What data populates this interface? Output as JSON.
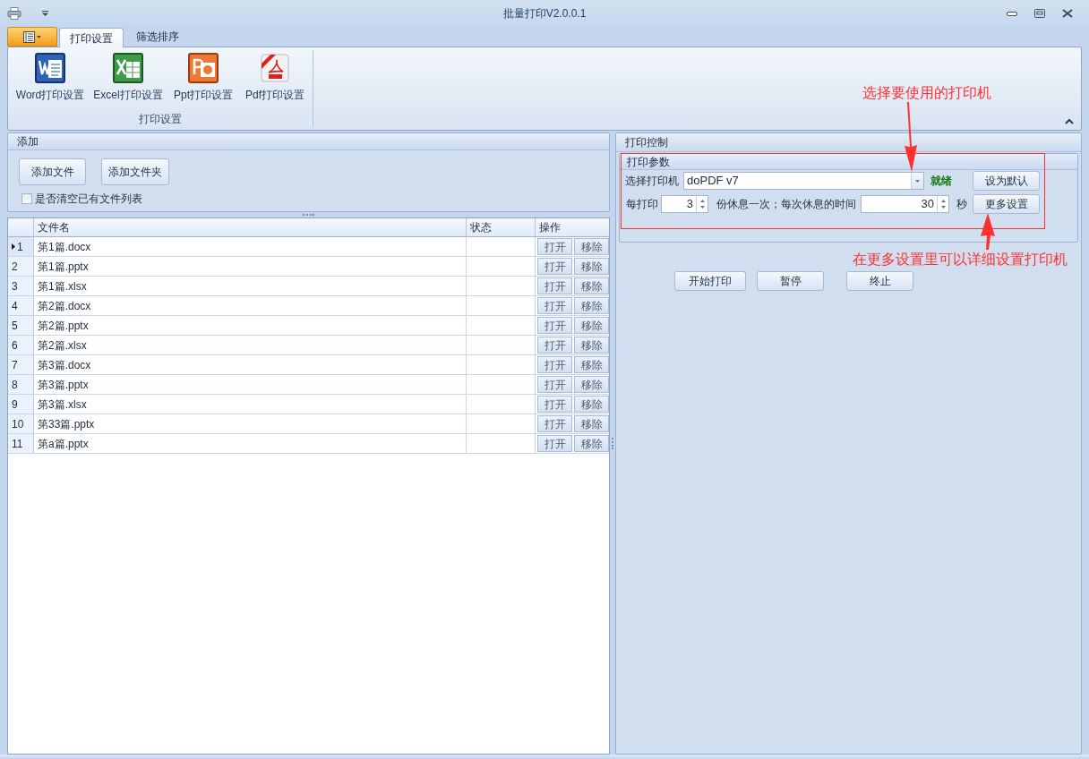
{
  "window": {
    "title": "批量打印V2.0.0.1"
  },
  "ribbon": {
    "tabs": [
      {
        "label": "打印设置",
        "selected": true
      },
      {
        "label": "筛选排序",
        "selected": false
      }
    ],
    "groups": [
      {
        "label": "打印设置",
        "buttons": [
          {
            "label": "Word打印设置",
            "kind": "word"
          },
          {
            "label": "Excel打印设置",
            "kind": "excel"
          },
          {
            "label": "Ppt打印设置",
            "kind": "ppt"
          },
          {
            "label": "Pdf打印设置",
            "kind": "pdf"
          }
        ]
      }
    ]
  },
  "add_panel": {
    "title": "添加",
    "buttons": [
      "添加文件",
      "添加文件夹"
    ],
    "clear_list": {
      "label": "是否清空已有文件列表",
      "checked": false
    }
  },
  "file_table": {
    "columns": [
      "文件名",
      "状态",
      "操作"
    ],
    "rows": [
      {
        "number": "1",
        "file": "第1篇.docx",
        "selected": true,
        "actions": [
          "打开",
          "移除"
        ]
      },
      {
        "number": "2",
        "file": "第1篇.pptx",
        "selected": false,
        "actions": [
          "打开",
          "移除"
        ]
      },
      {
        "number": "3",
        "file": "第1篇.xlsx",
        "selected": false,
        "actions": [
          "打开",
          "移除"
        ]
      },
      {
        "number": "4",
        "file": "第2篇.docx",
        "selected": false,
        "actions": [
          "打开",
          "移除"
        ]
      },
      {
        "number": "5",
        "file": "第2篇.pptx",
        "selected": false,
        "actions": [
          "打开",
          "移除"
        ]
      },
      {
        "number": "6",
        "file": "第2篇.xlsx",
        "selected": false,
        "actions": [
          "打开",
          "移除"
        ]
      },
      {
        "number": "7",
        "file": "第3篇.docx",
        "selected": false,
        "actions": [
          "打开",
          "移除"
        ]
      },
      {
        "number": "8",
        "file": "第3篇.pptx",
        "selected": false,
        "actions": [
          "打开",
          "移除"
        ]
      },
      {
        "number": "9",
        "file": "第3篇.xlsx",
        "selected": false,
        "actions": [
          "打开",
          "移除"
        ]
      },
      {
        "number": "10",
        "file": "第33篇.pptx",
        "selected": false,
        "actions": [
          "打开",
          "移除"
        ]
      },
      {
        "number": "11",
        "file": "第a篇.pptx",
        "selected": false,
        "actions": [
          "打开",
          "移除"
        ]
      }
    ]
  },
  "print_control": {
    "title": "打印控制",
    "params": {
      "title": "打印参数",
      "printer_label": "选择打印机",
      "printer": "doPDF v7",
      "status": "就绪",
      "set_default": "设为默认",
      "copies_label": "每打印",
      "copies": "3",
      "rest_label": "份休息一次；每次休息的时间",
      "rest_seconds": "30",
      "unit": "秒",
      "more_settings": "更多设置"
    },
    "buttons": [
      "开始打印",
      "暂停",
      "终止"
    ]
  },
  "annotations": [
    {
      "text": "选择要使用的打印机"
    },
    {
      "text": "在更多设置里可以详细设置打印机"
    }
  ]
}
